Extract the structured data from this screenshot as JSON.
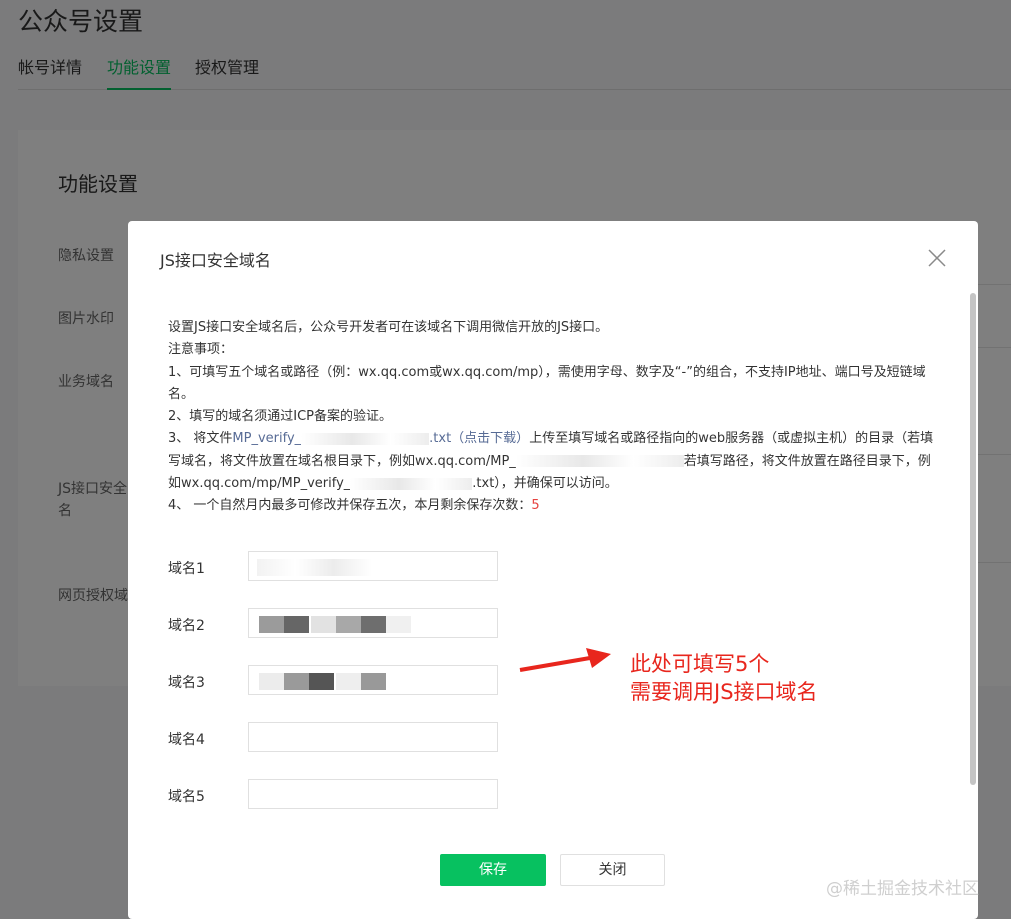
{
  "page": {
    "title": "公众号设置",
    "tabs": [
      {
        "label": "帐号详情"
      },
      {
        "label": "功能设置"
      },
      {
        "label": "授权管理"
      }
    ]
  },
  "card": {
    "title": "功能设置",
    "rows": [
      {
        "label": "隐私设置"
      },
      {
        "label": "图片水印"
      },
      {
        "label": "业务域名"
      },
      {
        "label": "JS接口安全"
      },
      {
        "label": "名"
      },
      {
        "label": "网页授权域"
      }
    ]
  },
  "dialog": {
    "title": "JS接口安全域名",
    "intro": "设置JS接口安全域名后，公众号开发者可在该域名下调用微信开放的JS接口。",
    "notice_title": "注意事项：",
    "item1": "1、可填写五个域名或路径（例：wx.qq.com或wx.qq.com/mp），需使用字母、数字及“-”的组合，不支持IP地址、端口号及短链域名。",
    "item2": "2、填写的域名须通过ICP备案的验证。",
    "item3_a": "3、 将文件",
    "item3_file": "MP_verify_",
    "item3_ext": ".txt（点击下载）",
    "item3_b": "上传至填写域名或路径指向的web服务器（或虚拟主机）的目录（若填写域名，将文件放置在域名根目录下，例如wx.qq.com/MP_",
    "item3_c": "若填写路径，将文件放置在路径目录下，例如wx.qq.com/mp/MP_verify_",
    "item3_d": ".txt），并确保可以访问。",
    "item4_a": "4、 一个自然月内最多可修改并保存五次，本月剩余保存次数：",
    "item4_count": "5",
    "fields": [
      {
        "label": "域名1"
      },
      {
        "label": "域名2"
      },
      {
        "label": "域名3"
      },
      {
        "label": "域名4"
      },
      {
        "label": "域名5"
      }
    ],
    "save_label": "保存",
    "close_label": "关闭"
  },
  "annotation": {
    "line1": "此处可填写5个",
    "line2": "需要调用JS接口域名"
  },
  "watermark": "@稀土掘金技术社区",
  "colors": {
    "accent": "#07c160",
    "link": "#576b95",
    "highlight": "#e64340",
    "annotation": "#e8261d"
  }
}
